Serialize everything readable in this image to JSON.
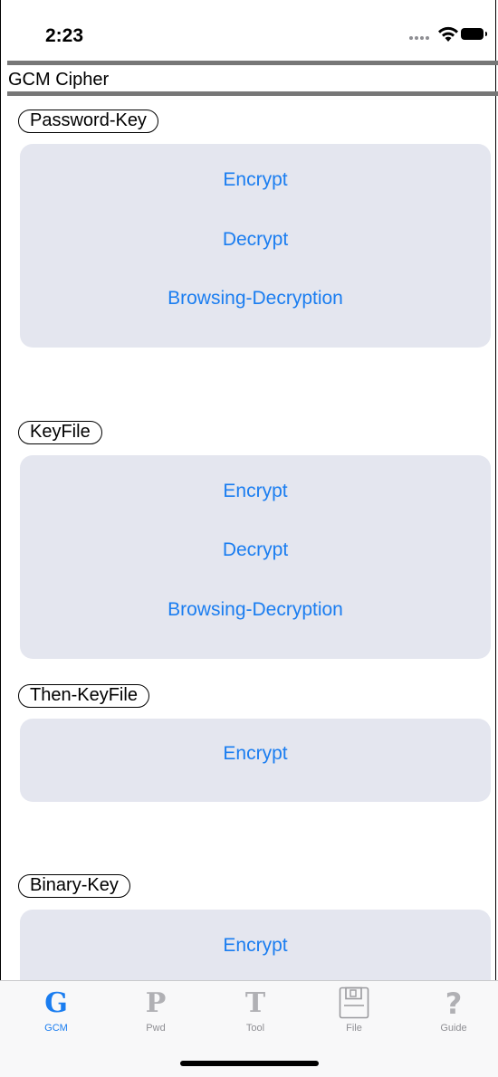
{
  "status_bar": {
    "time": "2:23"
  },
  "title": "GCM Cipher",
  "sections": [
    {
      "label": "Password-Key",
      "buttons": [
        "Encrypt",
        "Decrypt",
        "Browsing-Decryption"
      ]
    },
    {
      "label": "KeyFile",
      "buttons": [
        "Encrypt",
        "Decrypt",
        "Browsing-Decryption"
      ]
    },
    {
      "label": "Then-KeyFile",
      "buttons": [
        "Encrypt"
      ]
    },
    {
      "label": "Binary-Key",
      "buttons": [
        "Encrypt"
      ]
    }
  ],
  "tab_bar": {
    "active": "GCM",
    "tabs": [
      {
        "label": "GCM",
        "icon": "G",
        "icon_name": "gcm-icon"
      },
      {
        "label": "Pwd",
        "icon": "P",
        "icon_name": "pwd-icon"
      },
      {
        "label": "Tool",
        "icon": "T",
        "icon_name": "tool-icon"
      },
      {
        "label": "File",
        "icon": "floppy-disk",
        "icon_name": "floppy-disk-icon"
      },
      {
        "label": "Guide",
        "icon": "?",
        "icon_name": "question-mark-icon"
      }
    ]
  },
  "colors": {
    "accent": "#1a7df0",
    "card_bg": "#e4e6ef",
    "inactive_icon": "#b0b0b4"
  }
}
